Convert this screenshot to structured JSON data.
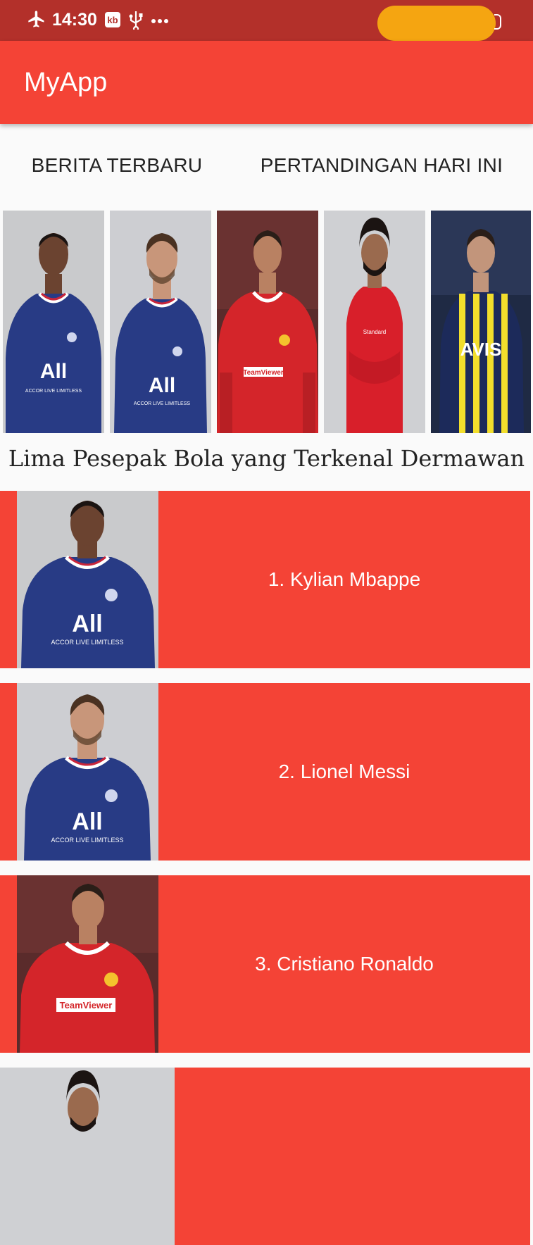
{
  "status_bar": {
    "time": "14:30",
    "icons": [
      "airplane-icon",
      "data-saver-icon",
      "usb-icon",
      "more-dots-icon",
      "battery-icon"
    ]
  },
  "app_bar": {
    "title": "MyApp"
  },
  "tabs": [
    {
      "label": "BERITA TERBARU"
    },
    {
      "label": "PERTANDINGAN HARI INI"
    }
  ],
  "gallery": {
    "images": [
      "player-photo",
      "player-photo",
      "player-photo",
      "player-photo",
      "player-photo"
    ]
  },
  "section": {
    "title": "Lima Pesepak Bola yang Terkenal Dermawan"
  },
  "players": [
    {
      "label": "1. Kylian Mbappe"
    },
    {
      "label": "2. Lionel Messi"
    },
    {
      "label": "3. Cristiano Ronaldo"
    },
    {
      "label": ""
    }
  ],
  "colors": {
    "status_bar": "#b3302a",
    "app_bar": "#f44336",
    "card": "#f44336",
    "pill": "#f5a511",
    "background": "#fafafa"
  }
}
